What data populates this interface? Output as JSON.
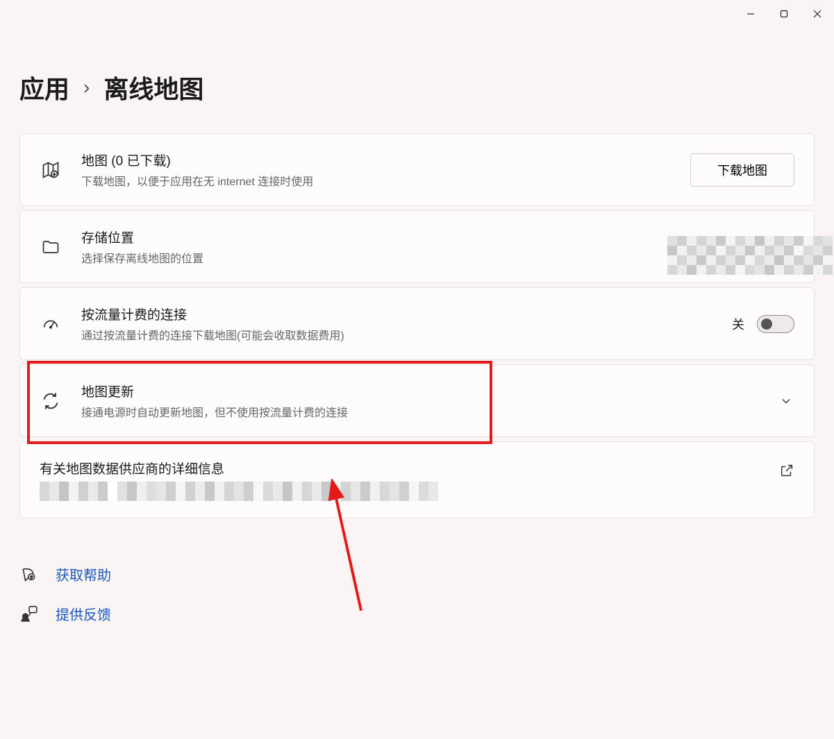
{
  "windowControls": [
    "minimize",
    "maximize",
    "close"
  ],
  "breadcrumb": {
    "parent": "应用",
    "current": "离线地图"
  },
  "cards": {
    "maps": {
      "title": "地图 (0 已下载)",
      "subtitle": "下载地图，以便于应用在无 internet 连接时使用",
      "button": "下载地图"
    },
    "storage": {
      "title": "存储位置",
      "subtitle": "选择保存离线地图的位置"
    },
    "metered": {
      "title": "按流量计费的连接",
      "subtitle": "通过按流量计费的连接下载地图(可能会收取数据费用)",
      "toggleLabel": "关",
      "toggleState": "off"
    },
    "updates": {
      "title": "地图更新",
      "subtitle": "接通电源时自动更新地图，但不使用按流量计费的连接"
    },
    "provider": {
      "title": "有关地图数据供应商的详细信息"
    }
  },
  "links": {
    "help": "获取帮助",
    "feedback": "提供反馈"
  }
}
